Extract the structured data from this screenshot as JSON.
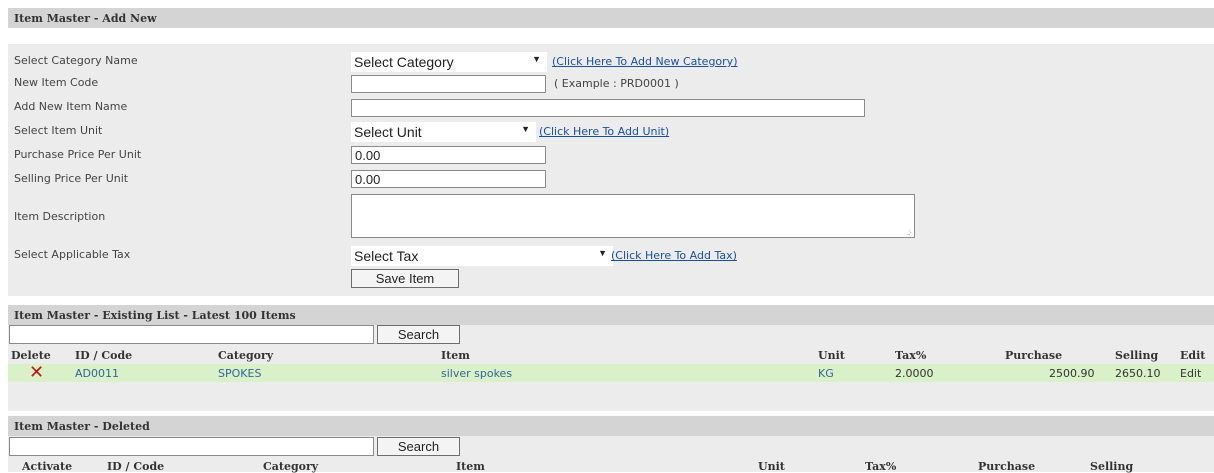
{
  "add_section": {
    "title": "Item Master - Add New",
    "fields": {
      "category": {
        "label": "Select Category Name",
        "value": "Select Category",
        "link": "(Click Here To Add New Category)"
      },
      "item_code": {
        "label": "New Item Code",
        "value": "",
        "hint": "( Example : PRD0001 )"
      },
      "item_name": {
        "label": "Add New Item Name",
        "value": ""
      },
      "unit": {
        "label": "Select Item Unit",
        "value": "Select Unit",
        "link": "(Click Here To Add Unit)"
      },
      "purchase_price": {
        "label": "Purchase Price Per Unit",
        "value": "0.00"
      },
      "selling_price": {
        "label": "Selling Price Per Unit",
        "value": "0.00"
      },
      "description": {
        "label": "Item Description",
        "value": ""
      },
      "tax": {
        "label": "Select Applicable Tax",
        "value": "Select Tax",
        "link": "(Click Here To Add Tax)"
      }
    },
    "save_label": "Save Item"
  },
  "existing_section": {
    "title": "Item Master - Existing List - Latest 100 Items",
    "search_value": "",
    "search_label": "Search",
    "columns": [
      "Delete",
      "ID / Code",
      "Category",
      "Item",
      "Unit",
      "Tax%",
      "Purchase",
      "Selling",
      "Edit"
    ],
    "rows": [
      {
        "id": "AD0011",
        "category": "SPOKES",
        "item": "silver spokes",
        "unit": "KG",
        "tax": "2.0000",
        "purchase": "2500.90",
        "selling": "2650.10",
        "edit": "Edit"
      }
    ]
  },
  "deleted_section": {
    "title": "Item Master - Deleted",
    "search_value": "",
    "search_label": "Search",
    "columns": [
      "Activate",
      "ID / Code",
      "Category",
      "Item",
      "Unit",
      "Tax%",
      "Purchase",
      "Selling"
    ]
  },
  "icons": {
    "delete": "close-x-icon",
    "dropdown": "triangle-down-icon"
  },
  "colors": {
    "header_bg": "#d4d4d4",
    "panel_bg": "#ececec",
    "row_highlight": "#d9f0c8",
    "delete_red": "#cc1111",
    "link_blue": "#1a4ea0"
  }
}
